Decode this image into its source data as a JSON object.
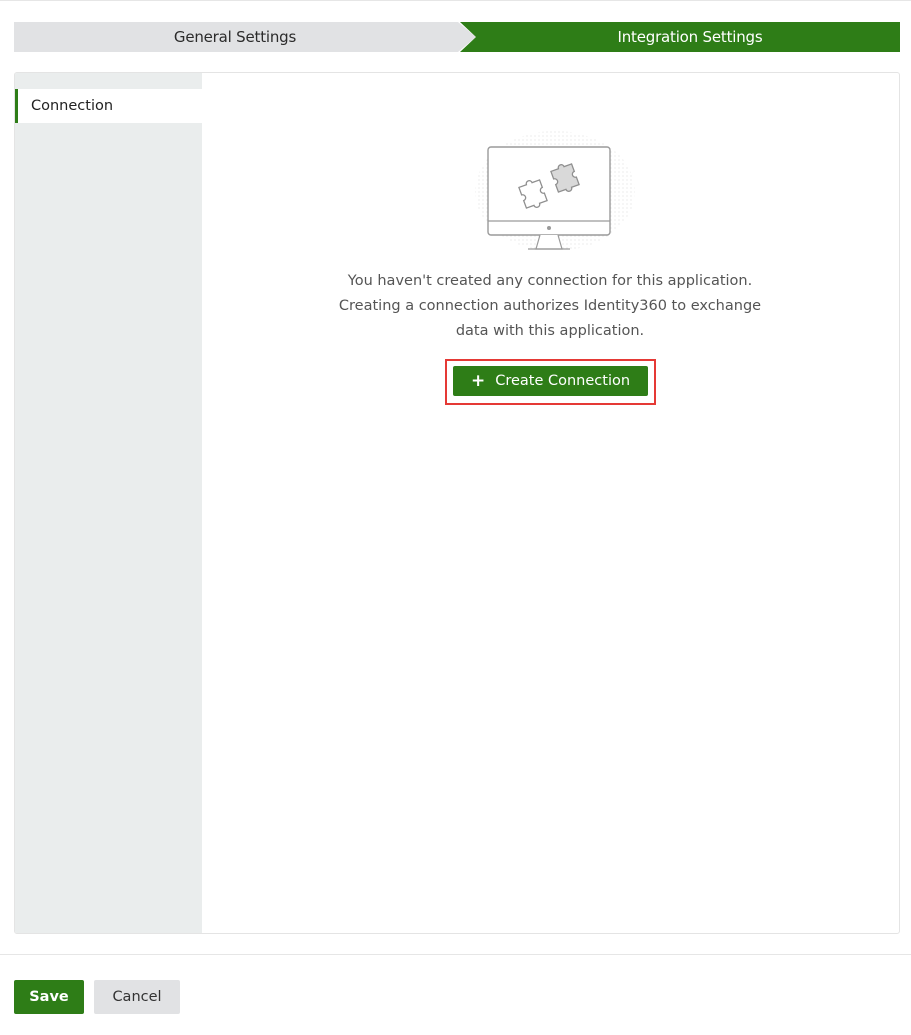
{
  "stepper": {
    "steps": [
      {
        "label": "General Settings",
        "state": "completed"
      },
      {
        "label": "Integration Settings",
        "state": "active"
      }
    ]
  },
  "sidebar": {
    "items": [
      {
        "label": "Connection",
        "selected": true
      }
    ]
  },
  "empty_state": {
    "illustration": "monitor-puzzle-icon",
    "line1": "You haven't created any connection for this application.",
    "line2": "Creating a connection authorizes Identity360 to exchange",
    "line3": "data with this application.",
    "button_icon": "+",
    "button_label": "Create Connection"
  },
  "footer": {
    "save_label": "Save",
    "cancel_label": "Cancel"
  },
  "colors": {
    "accent": "#2e7d17",
    "inactive_step": "#e1e2e4",
    "sidebar_bg": "#eaeded",
    "highlight": "#e53935"
  }
}
